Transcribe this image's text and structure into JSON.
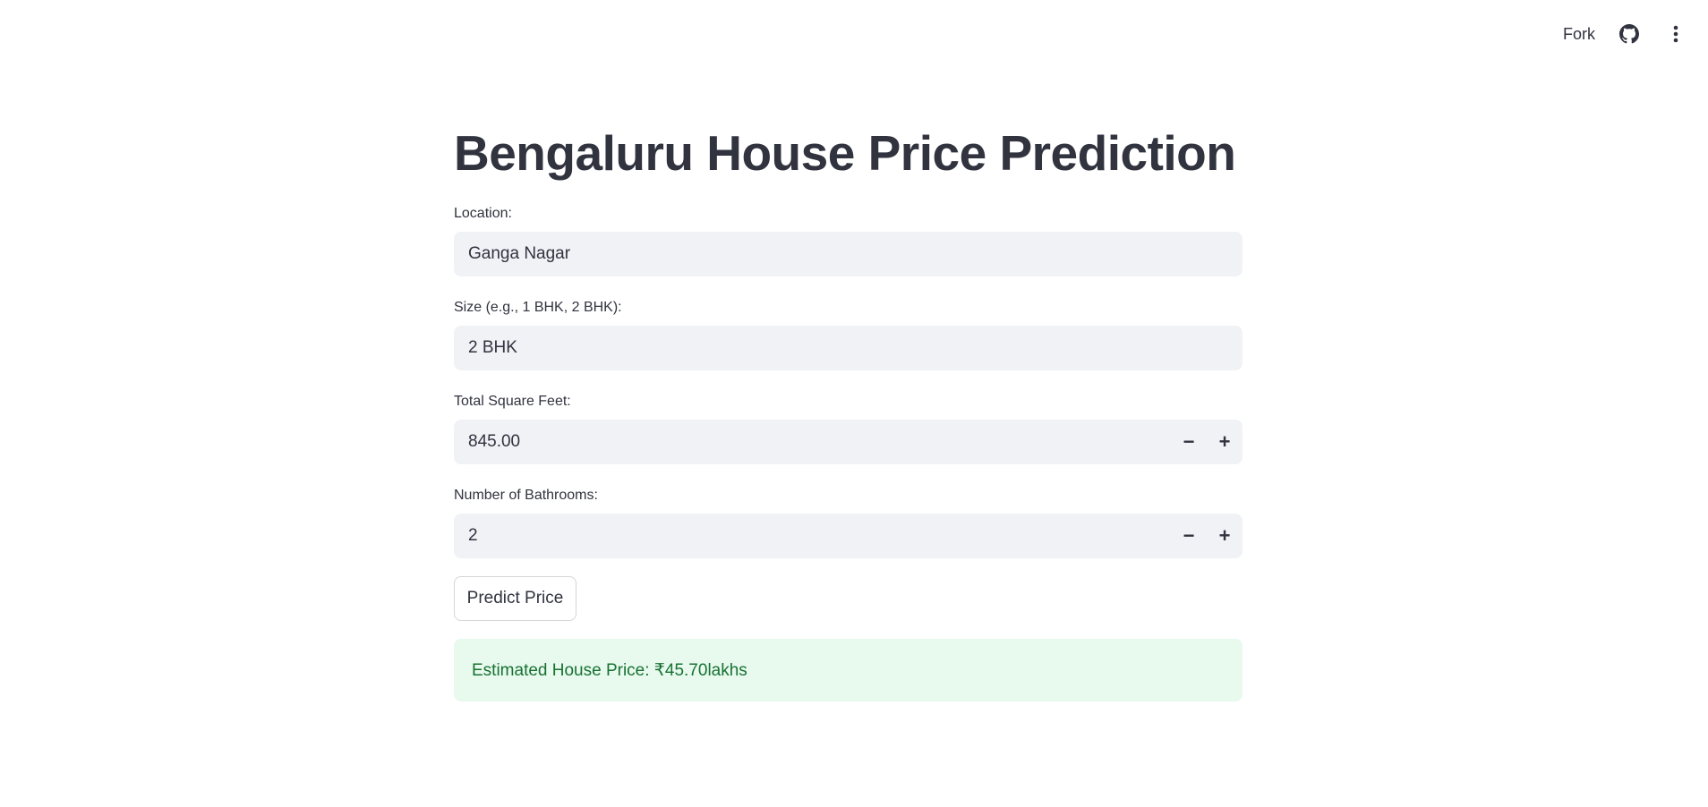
{
  "toolbar": {
    "fork_label": "Fork",
    "github_icon": "github-icon",
    "menu_icon": "vertical-ellipsis-icon"
  },
  "page": {
    "title": "Bengaluru House Price Prediction"
  },
  "form": {
    "location": {
      "label": "Location:",
      "value": "Ganga Nagar"
    },
    "size": {
      "label": "Size (e.g., 1 BHK, 2 BHK):",
      "value": "2 BHK"
    },
    "total_sqft": {
      "label": "Total Square Feet:",
      "value": "845.00",
      "decrement": "−",
      "increment": "+"
    },
    "bathrooms": {
      "label": "Number of Bathrooms:",
      "value": "2",
      "decrement": "−",
      "increment": "+"
    },
    "predict_button": "Predict Price"
  },
  "result": {
    "text": "Estimated House Price: ₹45.70lakhs"
  },
  "colors": {
    "text": "#31333f",
    "input_bg": "#f0f2f6",
    "success_bg": "#e8f9ee",
    "success_text": "#177233"
  }
}
